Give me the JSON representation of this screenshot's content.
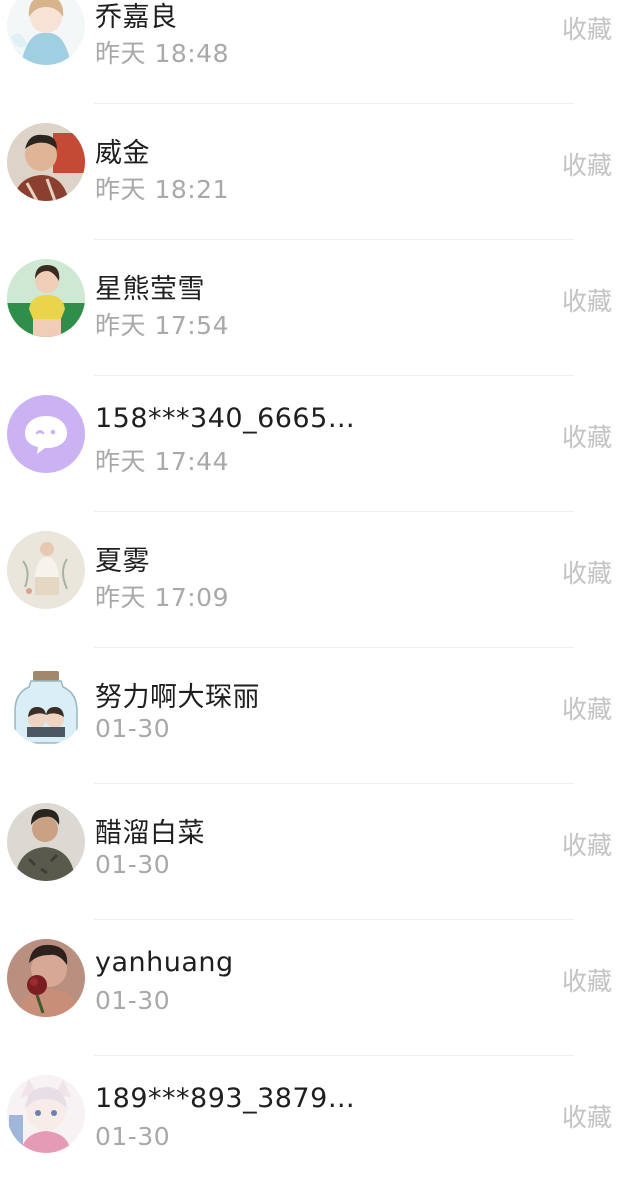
{
  "contacts": [
    {
      "name": "乔嘉良",
      "time": "昨天 18:48",
      "action": "收藏",
      "avatar": "anime-girl-avatar",
      "colors": [
        "#dff1f6",
        "#9fcfe0"
      ]
    },
    {
      "name": "威金",
      "time": "昨天 18:21",
      "action": "收藏",
      "avatar": "man-photo-avatar",
      "colors": [
        "#d8c4b1",
        "#b35a3c"
      ]
    },
    {
      "name": "星熊莹雪",
      "time": "昨天 17:54",
      "action": "收藏",
      "avatar": "woman-photo-avatar",
      "colors": [
        "#2f8f4a",
        "#e9d44a"
      ]
    },
    {
      "name": "158***340_6665…",
      "time": "昨天 17:44",
      "action": "收藏",
      "avatar": "chat-bubble-avatar",
      "colors": [
        "#cbb3f3",
        "#ffffff"
      ]
    },
    {
      "name": "夏雾",
      "time": "昨天 17:09",
      "action": "收藏",
      "avatar": "illustration-avatar",
      "colors": [
        "#ebe6dc",
        "#c9b8a3"
      ]
    },
    {
      "name": "努力啊大琛丽",
      "time": "01-30",
      "action": "收藏",
      "avatar": "jar-avatar",
      "colors": [
        "#cfe6ef",
        "#7a8e99"
      ]
    },
    {
      "name": "醋溜白菜",
      "time": "01-30",
      "action": "收藏",
      "avatar": "man-portrait-avatar",
      "colors": [
        "#d9d6d0",
        "#5a5a4c"
      ]
    },
    {
      "name": "yanhuang",
      "time": "01-30",
      "action": "收藏",
      "avatar": "man-rose-avatar",
      "colors": [
        "#c99a88",
        "#7a1e22"
      ]
    },
    {
      "name": "189***893_3879…",
      "time": "01-30",
      "action": "收藏",
      "avatar": "anime-cat-girl-avatar",
      "colors": [
        "#f4eef2",
        "#e59bb5"
      ]
    }
  ]
}
